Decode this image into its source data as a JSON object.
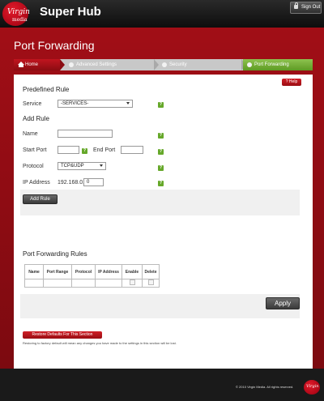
{
  "header": {
    "brand_top": "Virgin",
    "brand_bottom": "media",
    "title": "Super Hub",
    "signout_label": "Sign Out"
  },
  "page": {
    "title": "Port Forwarding"
  },
  "breadcrumb": [
    {
      "label": "Home"
    },
    {
      "label": "Advanced Settings"
    },
    {
      "label": "Security"
    },
    {
      "label": "Port Forwarding"
    }
  ],
  "help_label": "? Help",
  "predefined": {
    "heading": "Predefined Rule",
    "service_label": "Service",
    "service_value": "-SERVICES-"
  },
  "add_rule": {
    "heading": "Add Rule",
    "name_label": "Name",
    "name_value": "",
    "start_port_label": "Start Port",
    "start_port_value": "",
    "end_port_label": "End Port",
    "end_port_value": "",
    "protocol_label": "Protocol",
    "protocol_value": "TCP&UDP",
    "ip_label": "IP Address",
    "ip_prefix": "192.168.0.",
    "ip_last_octet": "0",
    "add_button": "Add Rule"
  },
  "rules_table": {
    "heading": "Port Forwarding Rules",
    "columns": [
      "Name",
      "Port Range",
      "Protocol",
      "IP Address",
      "Enable",
      "Delete"
    ]
  },
  "apply_button": "Apply",
  "restore": {
    "button": "Restore Defaults For This Section",
    "note": "Restoring to factory default will mean any changes you have made to the settings in this section will be lost."
  },
  "footer": {
    "copyright": "© 2010 Virgin Media. All rights reserved."
  },
  "colors": {
    "brand_red": "#a10e16",
    "active_green": "#7db443",
    "help_green": "#66a82a"
  }
}
